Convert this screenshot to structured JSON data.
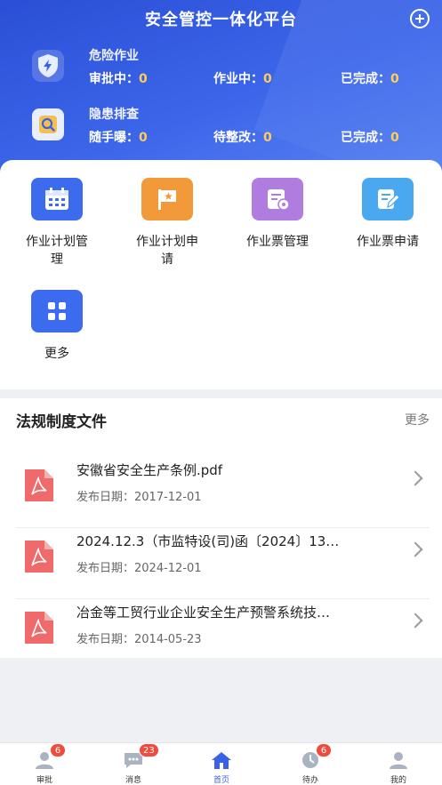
{
  "header": {
    "title": "安全管控一体化平台",
    "add_icon": "plus-circle-icon"
  },
  "dangerous_work": {
    "label": "危险作业",
    "icon": "shield-bolt-icon",
    "items": [
      {
        "label": "审批中：",
        "value": "0"
      },
      {
        "label": "作业中：",
        "value": "0"
      },
      {
        "label": "已完成：",
        "value": "0"
      }
    ]
  },
  "hazard_check": {
    "label": "隐患排查",
    "icon": "search-icon",
    "items": [
      {
        "label": "随手曝：",
        "value": "0"
      },
      {
        "label": "待整改：",
        "value": "0"
      },
      {
        "label": "已完成：",
        "value": "0"
      }
    ]
  },
  "quick_menu": [
    {
      "label": "作业计划管理",
      "icon": "calendar-icon",
      "color": "#3d6bf0"
    },
    {
      "label": "作业计划申请",
      "icon": "flag-icon",
      "color": "#f2993a"
    },
    {
      "label": "作业票管理",
      "icon": "ticket-settings-icon",
      "color": "#b07ce0"
    },
    {
      "label": "作业票申请",
      "icon": "edit-document-icon",
      "color": "#4aa8f0"
    },
    {
      "label": "更多",
      "icon": "grid-icon",
      "color": "#3d6bf0"
    }
  ],
  "regulations": {
    "title": "法规制度文件",
    "more": "更多",
    "items": [
      {
        "title": "安徽省安全生产条例.pdf",
        "date": "发布日期：2017-12-01"
      },
      {
        "title": "2024.12.3（市监特设(司)函〔2024〕13…",
        "date": "发布日期：2024-12-01"
      },
      {
        "title": "冶金等工贸行业企业安全生产预警系统技…",
        "date": "发布日期：2014-05-23"
      }
    ]
  },
  "tabbar": [
    {
      "label": "审批",
      "icon": "user-approve-icon",
      "badge": "6"
    },
    {
      "label": "消息",
      "icon": "message-icon",
      "badge": "23"
    },
    {
      "label": "首页",
      "icon": "home-icon",
      "badge": ""
    },
    {
      "label": "待办",
      "icon": "todo-icon",
      "badge": "6"
    },
    {
      "label": "我的",
      "icon": "profile-icon",
      "badge": ""
    }
  ],
  "accent_color": "#3a62e6"
}
